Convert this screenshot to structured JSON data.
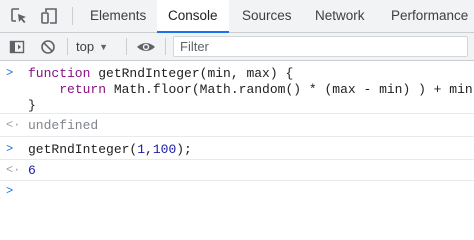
{
  "tabs": [
    {
      "label": "Elements",
      "active": false
    },
    {
      "label": "Console",
      "active": true
    },
    {
      "label": "Sources",
      "active": false
    },
    {
      "label": "Network",
      "active": false
    },
    {
      "label": "Performance",
      "active": false
    }
  ],
  "toolbar": {
    "context": "top",
    "filter_placeholder": "Filter"
  },
  "console": {
    "input1": {
      "keyword": "function",
      "signature": " getRndInteger(min, max) {",
      "body_indent": "    ",
      "return_kw": "return",
      "body_rest": " Math.floor(Math.random() * (max - min) ) + min;",
      "close": "}"
    },
    "result1": "undefined",
    "input2": {
      "call_head": "getRndInteger(",
      "arg1": "1",
      "comma": ",",
      "arg2": "100",
      "call_tail": ");"
    },
    "result2": "6"
  },
  "icons": [
    "inspect-element-icon",
    "device-toolbar-icon",
    "sidebar-toggle-icon",
    "clear-console-icon",
    "context-caret-icon",
    "live-expression-eye-icon",
    "input-prompt-icon",
    "result-arrow-icon"
  ],
  "colors": {
    "accent": "#1a73e8",
    "keyword": "#881280",
    "number": "#1a1aa6"
  }
}
